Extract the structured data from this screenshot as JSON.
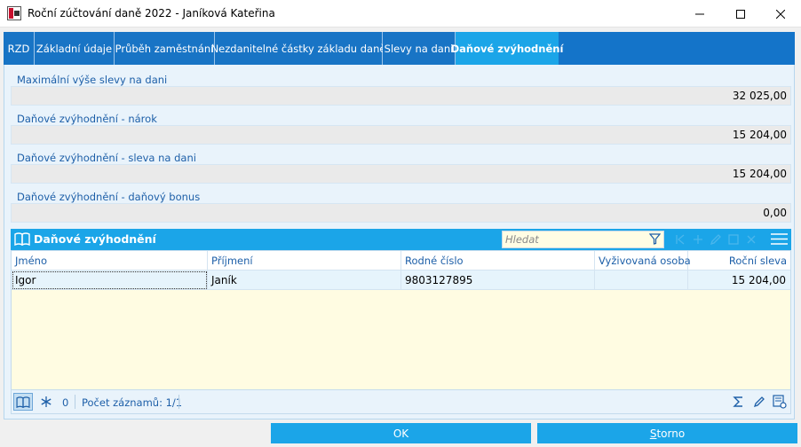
{
  "window": {
    "title": "Roční zúčtování daně 2022 - Janíková Kateřina",
    "app_icon": "k2-app-icon"
  },
  "tabs": [
    {
      "label": "RZD",
      "active": false
    },
    {
      "label": "Základní údaje",
      "active": false
    },
    {
      "label": "Průběh zaměstnání",
      "active": false
    },
    {
      "label": "Nezdanitelné částky základu daně",
      "active": false
    },
    {
      "label": "Slevy na dani",
      "active": false
    },
    {
      "label": "Daňové zvýhodnění",
      "active": true
    }
  ],
  "fields": [
    {
      "label": "Maximální výše slevy na dani",
      "value": "32 025,00"
    },
    {
      "label": "Daňové zvýhodnění - nárok",
      "value": "15 204,00"
    },
    {
      "label": "Daňové zvýhodnění - sleva na dani",
      "value": "15 204,00"
    },
    {
      "label": "Daňové zvýhodnění - daňový bonus",
      "value": "0,00"
    }
  ],
  "grid": {
    "title": "Daňové zvýhodnění",
    "search_placeholder": "Hledat",
    "columns": [
      "Jméno",
      "Příjmení",
      "Rodné číslo",
      "Vyživovaná osoba",
      "Roční sleva"
    ],
    "rows": [
      {
        "jmeno": "Igor",
        "prijmeni": "Janík",
        "rodne_cislo": "9803127895",
        "vyzivovana_osoba": "",
        "rocni_sleva": "15 204,00"
      }
    ]
  },
  "status": {
    "filter_count": "0",
    "record_count": "Počet záznamů: 1/1"
  },
  "footer": {
    "ok_label": "OK",
    "cancel_label_underlined": "S",
    "cancel_label_rest": "torno"
  },
  "colors": {
    "accent": "#1ba5e8",
    "tab_bg": "#1874c5",
    "label_text": "#1d5fa8",
    "grid_bg": "#fffce2"
  }
}
